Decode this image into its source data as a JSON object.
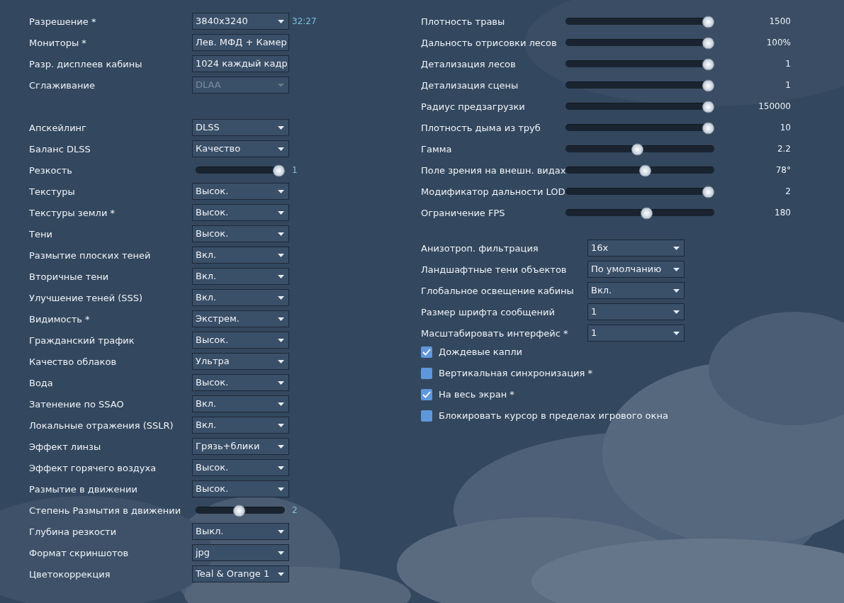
{
  "display": [
    {
      "kind": "select",
      "label": "Разрешение *",
      "value": "3840x3240",
      "disabled": false,
      "note": "32:27"
    },
    {
      "kind": "select",
      "label": "Мониторы *",
      "value": "Лев. МФД + Камер",
      "disabled": false
    },
    {
      "kind": "select",
      "label": "Разр. дисплеев кабины",
      "value": "1024 каждый кадр",
      "disabled": false
    },
    {
      "kind": "select",
      "label": "Сглаживание",
      "value": "DLAA",
      "disabled": true
    }
  ],
  "graphics": [
    {
      "kind": "select",
      "label": "Апскейлинг",
      "value": "DLSS",
      "disabled": false
    },
    {
      "kind": "select",
      "label": "Баланс DLSS",
      "value": "Качество",
      "disabled": false
    },
    {
      "kind": "slider",
      "label": "Резкость",
      "level": 1.0,
      "reading": "1"
    },
    {
      "kind": "select",
      "label": "Текстуры",
      "value": "Высок.",
      "disabled": false
    },
    {
      "kind": "select",
      "label": "Текстуры земли *",
      "value": "Высок.",
      "disabled": false
    },
    {
      "kind": "select",
      "label": "Тени",
      "value": "Высок.",
      "disabled": false
    },
    {
      "kind": "select",
      "label": "Размытие плоских теней",
      "value": "Вкл.",
      "disabled": false
    },
    {
      "kind": "select",
      "label": "Вторичные тени",
      "value": "Вкл.",
      "disabled": false
    },
    {
      "kind": "select",
      "label": "Улучшение теней (SSS)",
      "value": "Вкл.",
      "disabled": false
    },
    {
      "kind": "select",
      "label": "Видимость *",
      "value": "Экстрем.",
      "disabled": false
    },
    {
      "kind": "select",
      "label": "Гражданский трафик",
      "value": "Высок.",
      "disabled": false
    },
    {
      "kind": "select",
      "label": "Качество облаков",
      "value": "Ультра",
      "disabled": false
    },
    {
      "kind": "select",
      "label": "Вода",
      "value": "Высок.",
      "disabled": false
    },
    {
      "kind": "select",
      "label": "Затенение по SSAO",
      "value": "Вкл.",
      "disabled": false
    },
    {
      "kind": "select",
      "label": "Локальные отражения (SSLR)",
      "value": "Вкл.",
      "disabled": false
    },
    {
      "kind": "select",
      "label": "Эффект линзы",
      "value": "Грязь+блики",
      "disabled": false
    },
    {
      "kind": "select",
      "label": "Эффект горячего воздуха",
      "value": "Высок.",
      "disabled": false
    },
    {
      "kind": "select",
      "label": "Размытие в движении",
      "value": "Высок.",
      "disabled": false
    },
    {
      "kind": "slider",
      "label": "Степень Размытия в движении",
      "level": 0.49,
      "reading": "2"
    },
    {
      "kind": "select",
      "label": "Глубина резкости",
      "value": "Выкл.",
      "disabled": false
    },
    {
      "kind": "select",
      "label": "Формат скриншотов",
      "value": "jpg",
      "disabled": false
    },
    {
      "kind": "select",
      "label": "Цветокоррекция",
      "value": "Teal & Orange 1",
      "disabled": false
    }
  ],
  "sliders": [
    {
      "label": "Плотность травы",
      "level": 1.0,
      "reading": "1500"
    },
    {
      "label": "Дальность отрисовки лесов",
      "level": 1.0,
      "reading": "100%"
    },
    {
      "label": "Детализация лесов",
      "level": 1.0,
      "reading": "1"
    },
    {
      "label": "Детализация сцены",
      "level": 1.0,
      "reading": "1"
    },
    {
      "label": "Радиус предзагрузки",
      "level": 1.0,
      "reading": "150000"
    },
    {
      "label": "Плотность дыма из труб",
      "level": 1.0,
      "reading": "10"
    },
    {
      "label": "Гамма",
      "level": 0.48,
      "reading": "2.2"
    },
    {
      "label": "Поле зрения на внешн. видах",
      "level": 0.54,
      "reading": "78°"
    },
    {
      "label": "Модификатор дальности LOD",
      "level": 1.0,
      "reading": "2"
    },
    {
      "label": "Ограничение FPS",
      "level": 0.55,
      "reading": "180"
    }
  ],
  "selects": [
    {
      "label": "Анизотроп. фильтрация",
      "value": "16x"
    },
    {
      "label": "Ландшафтные тени объектов",
      "value": "По умолчанию"
    },
    {
      "label": "Глобальное освещение кабины",
      "value": "Вкл."
    },
    {
      "label": "Размер шрифта сообщений",
      "value": "1"
    },
    {
      "label": "Масштабировать интерфейс *",
      "value": "1"
    }
  ],
  "checkboxes": [
    {
      "label": "Дождевые капли",
      "checked": true
    },
    {
      "label": "Вертикальная синхронизация *",
      "checked": false
    },
    {
      "label": "На весь экран *",
      "checked": true
    },
    {
      "label": "Блокировать курсор в пределах игрового окна",
      "checked": false
    }
  ]
}
